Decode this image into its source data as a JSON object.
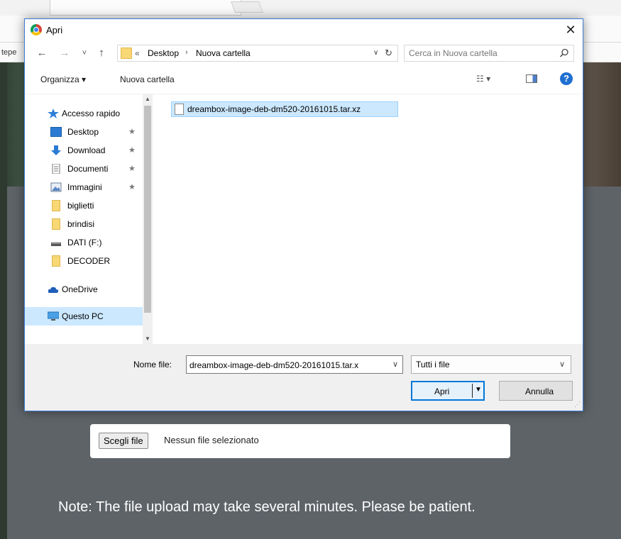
{
  "dialog": {
    "title": "Apri",
    "close_label": "✕",
    "nav": {
      "back": "←",
      "forward": "→",
      "recent": "˅",
      "up": "↑"
    },
    "address": {
      "overflow": "«",
      "crumbs": [
        "Desktop",
        "Nuova cartella"
      ],
      "separator": "›",
      "dropdown": "∨",
      "refresh": "↻"
    },
    "search": {
      "placeholder": "Cerca in Nuova cartella"
    },
    "commands": {
      "organize": "Organizza ▾",
      "new_folder": "Nuova cartella",
      "view": "☷ ▾",
      "help": "?"
    },
    "nav_pane": {
      "items": [
        {
          "label": "Accesso rapido",
          "icon": "star-icon",
          "pinned": false
        },
        {
          "label": "Desktop",
          "icon": "desktop-icon",
          "pinned": true
        },
        {
          "label": "Download",
          "icon": "download-icon",
          "pinned": true
        },
        {
          "label": "Documenti",
          "icon": "document-icon",
          "pinned": true
        },
        {
          "label": "Immagini",
          "icon": "image-icon",
          "pinned": true
        },
        {
          "label": "biglietti",
          "icon": "folder-icon",
          "pinned": false
        },
        {
          "label": "brindisi",
          "icon": "folder-icon",
          "pinned": false
        },
        {
          "label": "DATI (F:)",
          "icon": "drive-icon",
          "pinned": false
        },
        {
          "label": "DECODER",
          "icon": "folder-icon",
          "pinned": false
        },
        {
          "label": "OneDrive",
          "icon": "cloud-icon",
          "pinned": false
        },
        {
          "label": "Questo PC",
          "icon": "computer-icon",
          "pinned": false,
          "selected": true
        }
      ],
      "pin_glyph": "★"
    },
    "files": [
      {
        "name": "dreambox-image-deb-dm520-20161015.tar.xz",
        "selected": true
      }
    ],
    "bottom": {
      "filename_label": "Nome file:",
      "filename_value": "dreambox-image-deb-dm520-20161015.tar.x",
      "filetype_value": "Tutti i file",
      "open_label": "Apri",
      "cancel_label": "Annulla"
    }
  },
  "page": {
    "bookmarks_text": "tepe",
    "choose_file_label": "Scegli file",
    "choose_file_status": "Nessun file selezionato",
    "note": "Note: The file upload may take several minutes. Please be patient."
  },
  "colors": {
    "dialog_border": "#3c7bd6",
    "selection": "#cce8ff",
    "accent": "#0078d7",
    "page_bg": "#5e6368"
  }
}
